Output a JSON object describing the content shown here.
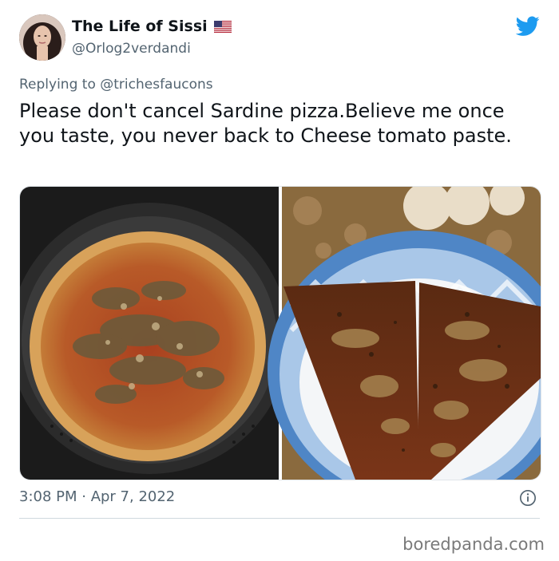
{
  "tweet": {
    "display_name": "The Life of Sissi",
    "handle": "@Orlog2verdandi",
    "replying_prefix": "Replying to ",
    "replying_to": "@trichesfaucons",
    "text": "Please don't cancel Sardine pizza.Believe me once you taste, you never back to Cheese tomato paste.",
    "timestamp": "3:08 PM · Apr 7, 2022",
    "flag_icon": "us-flag-icon",
    "platform_icon": "twitter-bird-icon",
    "info_icon": "info-icon"
  },
  "media": {
    "images": [
      "whole-sardine-pizza-in-pan",
      "sardine-pizza-slices-on-plate"
    ]
  },
  "watermark": "boredpanda.com",
  "colors": {
    "twitter_blue": "#1d9bf0",
    "secondary_text": "#536471",
    "primary_text": "#0f1419"
  }
}
